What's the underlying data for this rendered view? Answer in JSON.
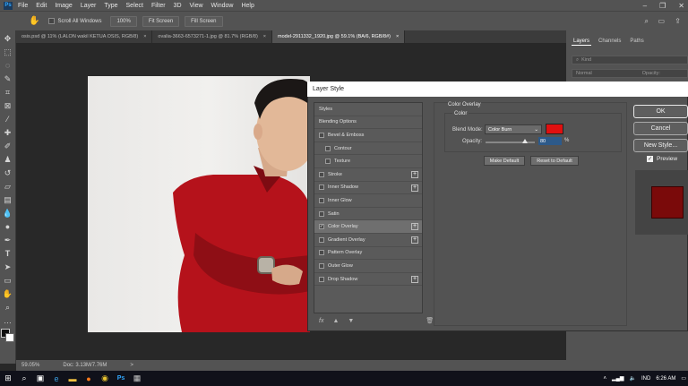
{
  "menu": {
    "logo": "Ps",
    "items": [
      "File",
      "Edit",
      "Image",
      "Layer",
      "Type",
      "Select",
      "Filter",
      "3D",
      "View",
      "Window",
      "Help"
    ],
    "window_controls": [
      "–",
      "❐",
      "✕"
    ]
  },
  "options": {
    "scroll_all_windows": "Scroll All Windows",
    "zoom_value": "100%",
    "fit_screen": "Fit Screen",
    "fill_screen": "Fill Screen"
  },
  "tabs": [
    {
      "label": "osis.psd @ 11% (LALON wakil KETUA OSIS, RGB/8)",
      "close": "×"
    },
    {
      "label": "ovalia-3663-6573271-1.jpg @ 81.7% (RGB/8)",
      "close": "×"
    },
    {
      "label": "model-2911332_1920.jpg @ 59.1% (BA/6, RGB/8#)",
      "close": "×"
    }
  ],
  "status": {
    "zoom": "59.05%",
    "doc": "Doc: 3.13M/7.76M",
    "arrow": ">"
  },
  "right_panel": {
    "tabs": [
      "Layers",
      "Channels",
      "Paths"
    ],
    "kind_placeholder": "Kind",
    "mode": "Normal",
    "opacity_label": "Opacity:"
  },
  "dialog": {
    "title": "Layer Style",
    "styles_header": "Styles",
    "items": [
      {
        "label": "Blending Options",
        "checkbox": false,
        "plus": false,
        "indent": false,
        "checked": false
      },
      {
        "label": "Bevel & Emboss",
        "checkbox": true,
        "plus": false,
        "indent": false,
        "checked": false
      },
      {
        "label": "Contour",
        "checkbox": true,
        "plus": false,
        "indent": true,
        "checked": false
      },
      {
        "label": "Texture",
        "checkbox": true,
        "plus": false,
        "indent": true,
        "checked": false
      },
      {
        "label": "Stroke",
        "checkbox": true,
        "plus": true,
        "indent": false,
        "checked": false
      },
      {
        "label": "Inner Shadow",
        "checkbox": true,
        "plus": true,
        "indent": false,
        "checked": false
      },
      {
        "label": "Inner Glow",
        "checkbox": true,
        "plus": false,
        "indent": false,
        "checked": false
      },
      {
        "label": "Satin",
        "checkbox": true,
        "plus": false,
        "indent": false,
        "checked": false
      },
      {
        "label": "Color Overlay",
        "checkbox": true,
        "plus": true,
        "indent": false,
        "checked": true
      },
      {
        "label": "Gradient Overlay",
        "checkbox": true,
        "plus": true,
        "indent": false,
        "checked": false
      },
      {
        "label": "Pattern Overlay",
        "checkbox": true,
        "plus": false,
        "indent": false,
        "checked": false
      },
      {
        "label": "Outer Glow",
        "checkbox": true,
        "plus": false,
        "indent": false,
        "checked": false
      },
      {
        "label": "Drop Shadow",
        "checkbox": true,
        "plus": true,
        "indent": false,
        "checked": false
      }
    ],
    "footer_icons": [
      "fx",
      "▲",
      "▼",
      "🗑"
    ],
    "color_overlay": {
      "title": "Color Overlay",
      "group": "Color",
      "blend_mode_label": "Blend Mode:",
      "blend_mode_value": "Color Burn",
      "overlay_color": "#e01010",
      "opacity_label": "Opacity:",
      "opacity_value": "80",
      "opacity_fraction": 0.8,
      "percent": "%",
      "make_default": "Make Default",
      "reset_default": "Reset to Default"
    },
    "buttons": {
      "ok": "OK",
      "cancel": "Cancel",
      "new_style": "New Style..."
    },
    "preview_label": "Preview",
    "preview_checked": true
  },
  "taskbar": {
    "lang": "IND",
    "time": "6:26 AM"
  }
}
